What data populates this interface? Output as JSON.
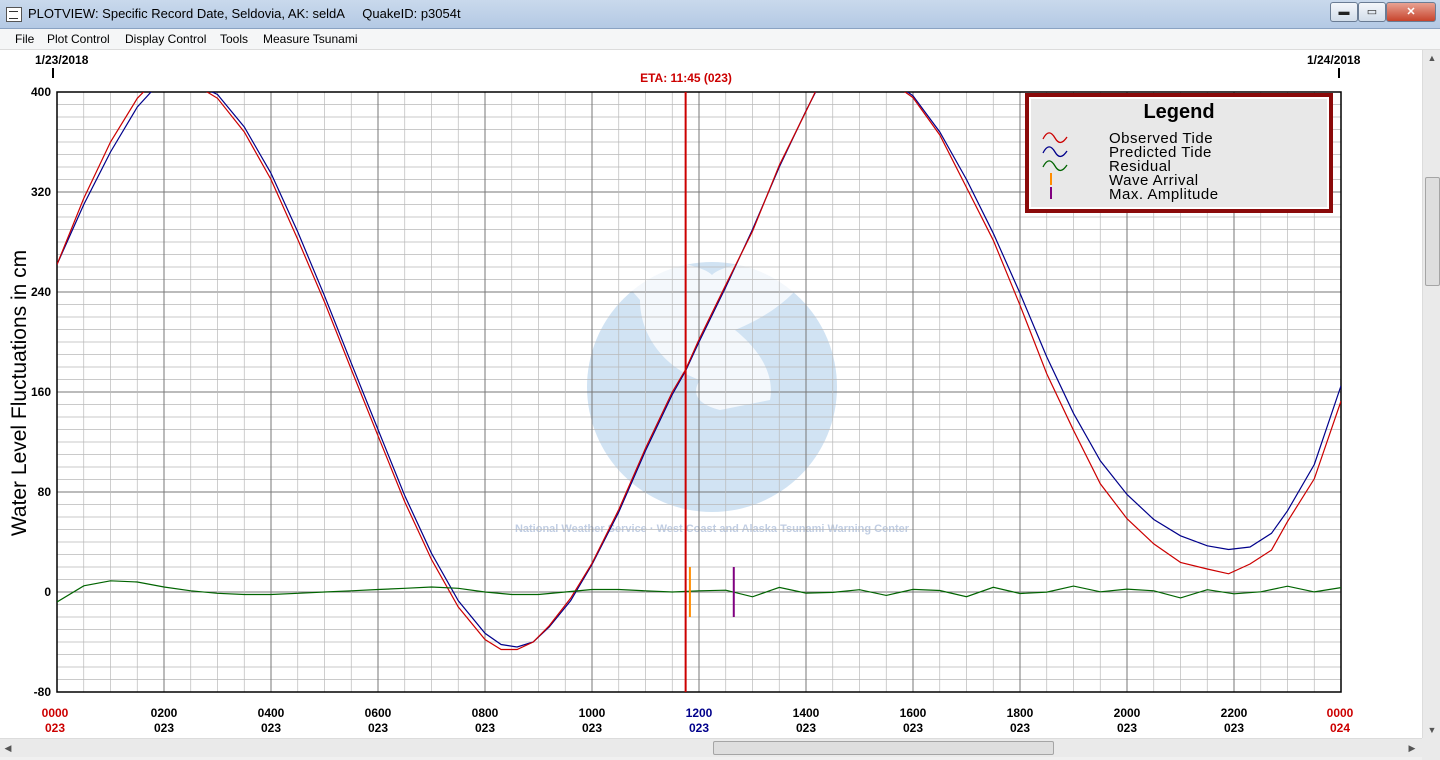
{
  "window": {
    "title": "PLOTVIEW: Specific Record Date, Seldovia, AK: seldA     QuakeID: p3054t",
    "minimize": "▬",
    "maximize": "▭",
    "close": "✕"
  },
  "menu": [
    "File",
    "Plot Control",
    "Display Control",
    "Tools",
    "Measure Tsunami"
  ],
  "plot": {
    "date_left": "1/23/2018",
    "date_right": "1/24/2018",
    "eta_label": "ETA: 11:45 (023)",
    "ylabel": "Water Level Fluctuations in cm",
    "watermark_text": "National Weather Service · West Coast and Alaska Tsunami Warning Center"
  },
  "legend": {
    "title": "Legend",
    "items": [
      {
        "label": "Observed Tide",
        "color": "#cc0000",
        "symbol": "wave-icon"
      },
      {
        "label": "Predicted Tide",
        "color": "#00008b",
        "symbol": "wave-icon"
      },
      {
        "label": "Residual",
        "color": "#006400",
        "symbol": "wave-icon"
      },
      {
        "label": "Wave Arrival",
        "color": "#ff8c00",
        "symbol": "bar-icon"
      },
      {
        "label": "Max. Amplitude",
        "color": "#800080",
        "symbol": "bar-icon"
      }
    ]
  },
  "chart_data": {
    "type": "line",
    "x_unit": "hours",
    "xlim": [
      0,
      24
    ],
    "ylim": [
      -80,
      400
    ],
    "y_ticks": [
      -80,
      0,
      80,
      160,
      240,
      320,
      400
    ],
    "x_ticks": [
      {
        "time": "0000",
        "day": "023",
        "hour": 0,
        "color": "#cc0000"
      },
      {
        "time": "0200",
        "day": "023",
        "hour": 2,
        "color": "#000000"
      },
      {
        "time": "0400",
        "day": "023",
        "hour": 4,
        "color": "#000000"
      },
      {
        "time": "0600",
        "day": "023",
        "hour": 6,
        "color": "#000000"
      },
      {
        "time": "0800",
        "day": "023",
        "hour": 8,
        "color": "#000000"
      },
      {
        "time": "1000",
        "day": "023",
        "hour": 10,
        "color": "#000000"
      },
      {
        "time": "1200",
        "day": "023",
        "hour": 12,
        "color": "#00008b"
      },
      {
        "time": "1400",
        "day": "023",
        "hour": 14,
        "color": "#000000"
      },
      {
        "time": "1600",
        "day": "023",
        "hour": 16,
        "color": "#000000"
      },
      {
        "time": "1800",
        "day": "023",
        "hour": 18,
        "color": "#000000"
      },
      {
        "time": "2000",
        "day": "023",
        "hour": 20,
        "color": "#000000"
      },
      {
        "time": "2200",
        "day": "023",
        "hour": 22,
        "color": "#000000"
      },
      {
        "time": "0000",
        "day": "024",
        "hour": 24,
        "color": "#cc0000"
      }
    ],
    "eta_hour": 11.75,
    "wave_arrival": {
      "hour": 11.83,
      "range": [
        -20,
        20
      ]
    },
    "max_amplitude": {
      "hour": 12.65,
      "range": [
        -20,
        20
      ]
    },
    "series": [
      {
        "name": "Observed Tide",
        "color": "#cc0000",
        "x": [
          0,
          0.5,
          1,
          1.5,
          1.8,
          2,
          2.5,
          3,
          3.5,
          4,
          4.5,
          5,
          5.5,
          6,
          6.5,
          7,
          7.5,
          8,
          8.3,
          8.6,
          8.9,
          9.2,
          9.6,
          10,
          10.5,
          11,
          11.5,
          11.75,
          12,
          12.5,
          13,
          13.5,
          14,
          14.3,
          15,
          15.5,
          16,
          16.5,
          17,
          17.5,
          18,
          18.5,
          19,
          19.5,
          20,
          20.5,
          21,
          21.5,
          21.9,
          22.3,
          22.7,
          23,
          23.5,
          24
        ],
        "y": [
          262,
          315,
          360,
          395,
          408,
          412,
          408,
          395,
          368,
          330,
          282,
          232,
          178,
          125,
          72,
          26,
          -12,
          -38,
          -46,
          -46,
          -40,
          -27,
          -5,
          23,
          66,
          115,
          160,
          178,
          202,
          245,
          290,
          340,
          385,
          410,
          418,
          412,
          395,
          365,
          325,
          280,
          230,
          175,
          128,
          88,
          58,
          38,
          25,
          17,
          16,
          21,
          35,
          55,
          92,
          152
        ]
      },
      {
        "name": "Predicted Tide",
        "color": "#00008b",
        "x": [
          0,
          0.5,
          1,
          1.5,
          1.8,
          2,
          2.5,
          3,
          3.5,
          4,
          4.5,
          5,
          5.5,
          6,
          6.5,
          7,
          7.5,
          8,
          8.3,
          8.6,
          8.9,
          9.2,
          9.6,
          10,
          10.5,
          11,
          11.5,
          11.75,
          12,
          12.5,
          13,
          13.5,
          14,
          14.3,
          15,
          15.5,
          16,
          16.5,
          17,
          17.5,
          18,
          18.5,
          19,
          19.5,
          20,
          20.5,
          21,
          21.5,
          21.9,
          22.3,
          22.7,
          23,
          23.5,
          24
        ],
        "y": [
          262,
          310,
          352,
          388,
          402,
          408,
          408,
          398,
          372,
          335,
          288,
          237,
          183,
          130,
          77,
          31,
          -7,
          -33,
          -42,
          -44,
          -40,
          -28,
          -7,
          22,
          64,
          113,
          158,
          177,
          200,
          244,
          290,
          340,
          385,
          410,
          419,
          412,
          397,
          368,
          330,
          287,
          239,
          188,
          143,
          105,
          78,
          58,
          45,
          37,
          34,
          36,
          47,
          65,
          102,
          165
        ]
      },
      {
        "name": "Residual",
        "color": "#006400",
        "x": [
          0,
          0.5,
          1,
          1.5,
          2,
          2.5,
          3,
          3.5,
          4,
          4.5,
          5,
          5.5,
          6,
          6.5,
          7,
          7.5,
          8,
          8.5,
          9,
          9.5,
          10,
          10.5,
          11,
          11.5,
          12,
          12.5,
          13,
          13.5,
          14,
          14.5,
          15,
          15.5,
          16,
          16.5,
          17,
          17.5,
          18,
          18.5,
          19,
          19.5,
          20,
          20.5,
          21,
          21.5,
          22,
          22.5,
          23,
          23.5,
          24
        ],
        "y": [
          -8,
          5,
          9,
          8,
          4,
          1,
          -1,
          -2,
          -2,
          -1,
          0,
          1,
          2,
          3,
          4,
          3,
          0,
          -2,
          -2,
          0,
          2,
          2,
          1,
          0,
          1,
          0,
          -1,
          1,
          0,
          1,
          -1,
          0,
          1,
          0,
          -1,
          1,
          0,
          1,
          2,
          3,
          1,
          0,
          -2,
          -1,
          0,
          1,
          2,
          3,
          2
        ]
      }
    ]
  }
}
